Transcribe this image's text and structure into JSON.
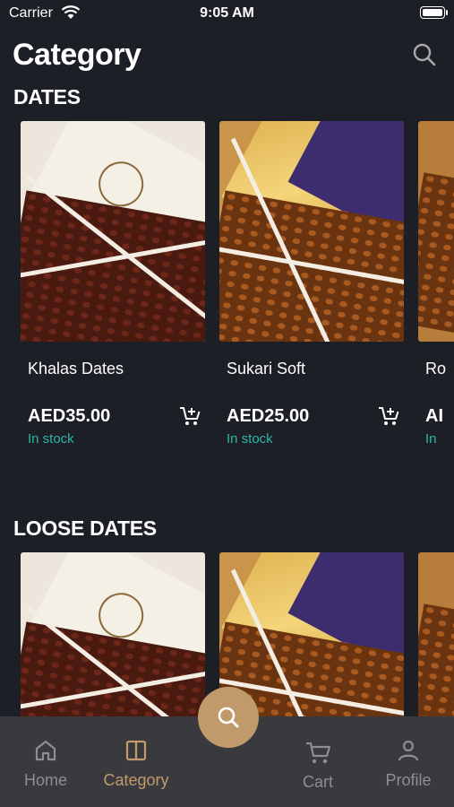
{
  "status_bar": {
    "carrier": "Carrier",
    "time": "9:05 AM"
  },
  "header": {
    "title": "Category"
  },
  "sections": [
    {
      "title": "DATES",
      "products": [
        {
          "name": "Khalas Dates",
          "price": "AED35.00",
          "stock": "In stock",
          "image": "khalas-box"
        },
        {
          "name": "Sukari Soft",
          "price": "AED25.00",
          "stock": "In stock",
          "image": "sukari-box"
        },
        {
          "name": "Ro",
          "price": "AI",
          "stock": "In",
          "image": "partial-box"
        }
      ]
    },
    {
      "title": "LOOSE DATES",
      "products": [
        {
          "image": "khalas-box"
        },
        {
          "image": "sukari-box"
        },
        {
          "image": "partial-box"
        }
      ]
    }
  ],
  "bottom_nav": {
    "items": [
      {
        "label": "Home",
        "icon": "home-icon",
        "active": false
      },
      {
        "label": "Category",
        "icon": "category-icon",
        "active": true
      },
      {
        "label": "Cart",
        "icon": "cart-icon",
        "active": false
      },
      {
        "label": "Profile",
        "icon": "profile-icon",
        "active": false
      }
    ],
    "fab_icon": "search-icon"
  },
  "colors": {
    "background": "#1d1f26",
    "accent": "#c19a6b",
    "in_stock": "#2fb5a6",
    "nav_bar": "#3a3a3e",
    "nav_inactive": "#8d8d92"
  }
}
